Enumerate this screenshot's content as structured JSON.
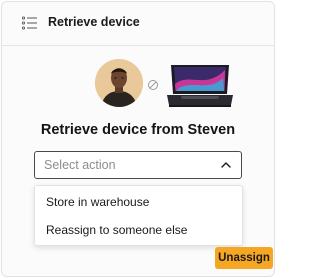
{
  "header": {
    "title": "Retrieve device",
    "icon": "list-icon"
  },
  "illustration": {
    "avatar_icon": "person-avatar",
    "separator_icon": "unlink-icon",
    "device_icon": "laptop-icon"
  },
  "main": {
    "title": "Retrieve device from Steven"
  },
  "select": {
    "placeholder": "Select action",
    "expanded": true,
    "options": [
      {
        "label": "Store in warehouse"
      },
      {
        "label": "Reassign to someone else"
      }
    ]
  },
  "actions": {
    "unassign_label": "Unassign"
  },
  "colors": {
    "accent": "#f5a623",
    "border": "#4a4a4a",
    "placeholder": "#8d8d8d"
  }
}
